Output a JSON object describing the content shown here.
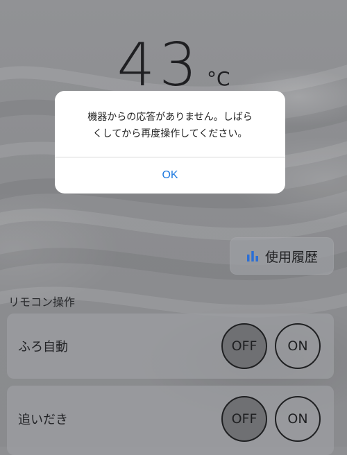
{
  "temperature": {
    "value": "43",
    "unit": "°C"
  },
  "history_button": {
    "label": "使用履歴",
    "icon": "bar-chart-icon",
    "icon_color": "#2b6fd6"
  },
  "remote_section": {
    "title": "リモコン操作",
    "rows": [
      {
        "label": "ふろ自動",
        "off_label": "OFF",
        "on_label": "ON",
        "selected": "OFF"
      },
      {
        "label": "追いだき",
        "off_label": "OFF",
        "on_label": "ON",
        "selected": "OFF"
      }
    ]
  },
  "alert": {
    "message_line1": "機器からの応答がありません。しばら",
    "message_line2": "くしてから再度操作してください。",
    "ok_label": "OK",
    "ok_color": "#1f7ae0"
  }
}
